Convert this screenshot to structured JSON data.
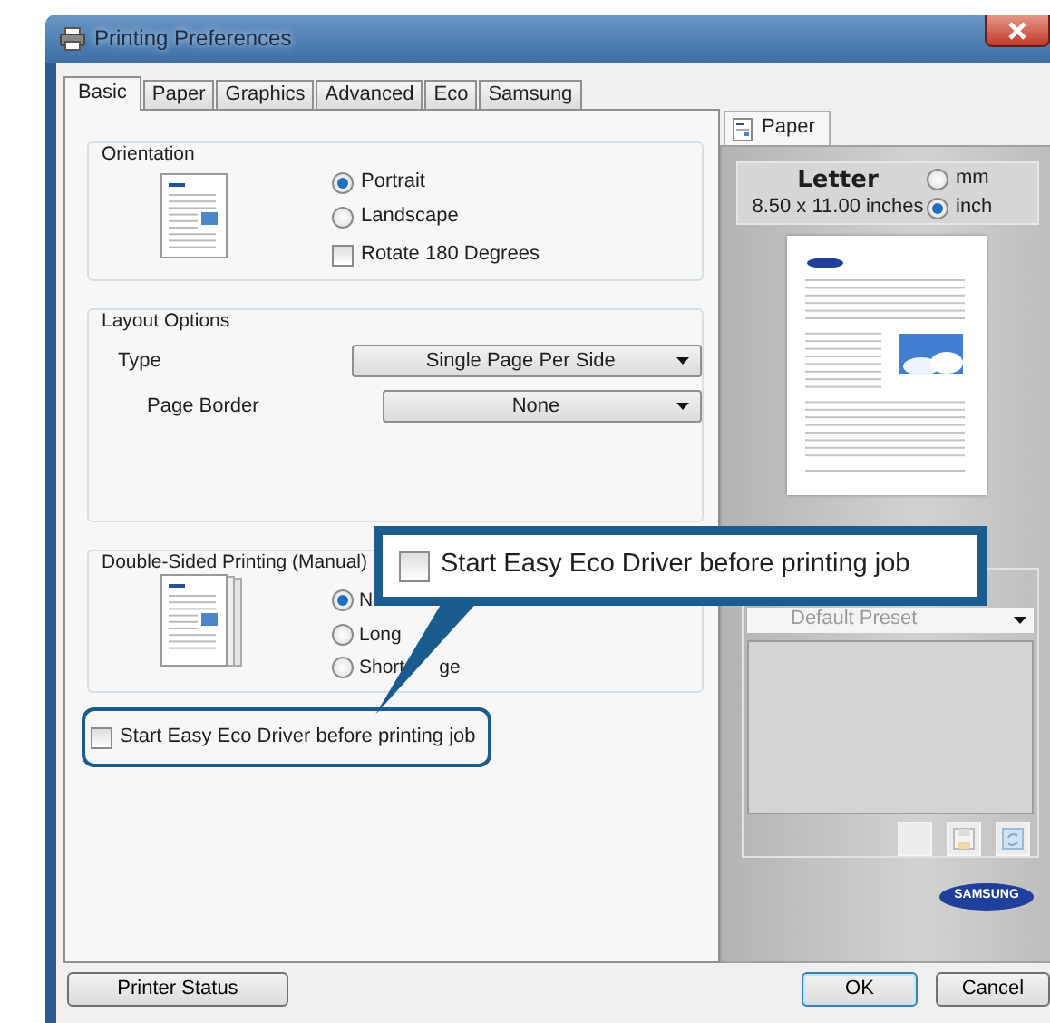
{
  "window": {
    "title": "Printing Preferences"
  },
  "tabs": [
    {
      "label": "Basic",
      "selected": true
    },
    {
      "label": "Paper",
      "selected": false
    },
    {
      "label": "Graphics",
      "selected": false
    },
    {
      "label": "Advanced",
      "selected": false
    },
    {
      "label": "Eco",
      "selected": false
    },
    {
      "label": "Samsung",
      "selected": false
    }
  ],
  "orientation": {
    "title": "Orientation",
    "options": [
      {
        "label": "Portrait",
        "selected": true
      },
      {
        "label": "Landscape",
        "selected": false
      }
    ],
    "rotate": {
      "label": "Rotate 180 Degrees",
      "checked": false
    }
  },
  "layout_options": {
    "title": "Layout Options",
    "fields": [
      {
        "label": "Type",
        "value": "Single Page Per Side",
        "children": [
          {
            "label": "Page Border",
            "value": "None"
          }
        ]
      }
    ]
  },
  "double_sided": {
    "title": "Double-Sided Printing (Manual)",
    "options": [
      {
        "label": "N",
        "selected": true
      },
      {
        "label": "Long",
        "selected": false
      },
      {
        "label": "Short",
        "tail": "ge",
        "selected": false
      }
    ]
  },
  "eco_checkbox": {
    "label": "Start Easy Eco Driver before printing job",
    "checked": false
  },
  "side_panel": {
    "tab": "Paper",
    "paper_name": "Letter",
    "paper_size": "8.50 x 11.00 inches",
    "units": [
      {
        "label": "mm",
        "selected": false
      },
      {
        "label": "inch",
        "selected": true
      }
    ],
    "preset": "Default Preset",
    "logo": "SAMSUNG"
  },
  "callout": {
    "label": "Start Easy Eco Driver before printing job",
    "checked": false
  },
  "buttons": [
    {
      "label": "Printer Status",
      "default": false
    },
    {
      "label": "OK",
      "default": true
    },
    {
      "label": "Cancel",
      "default": false
    }
  ]
}
